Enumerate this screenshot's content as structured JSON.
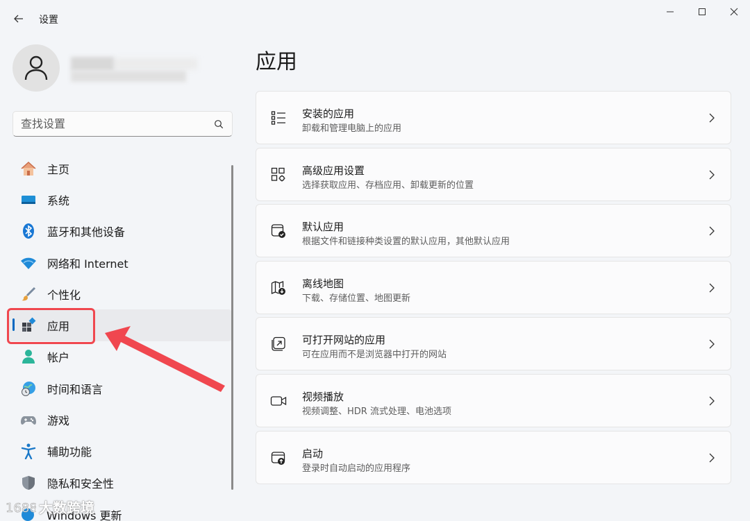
{
  "window": {
    "title": "设置"
  },
  "search": {
    "placeholder": "查找设置"
  },
  "nav": {
    "items": [
      {
        "label": "主页",
        "icon": "home-icon"
      },
      {
        "label": "系统",
        "icon": "system-icon"
      },
      {
        "label": "蓝牙和其他设备",
        "icon": "bluetooth-icon"
      },
      {
        "label": "网络和 Internet",
        "icon": "wifi-icon"
      },
      {
        "label": "个性化",
        "icon": "brush-icon"
      },
      {
        "label": "应用",
        "icon": "apps-icon",
        "active": true
      },
      {
        "label": "帐户",
        "icon": "account-icon"
      },
      {
        "label": "时间和语言",
        "icon": "globe-clock-icon"
      },
      {
        "label": "游戏",
        "icon": "gamepad-icon"
      },
      {
        "label": "辅助功能",
        "icon": "accessibility-icon"
      },
      {
        "label": "隐私和安全性",
        "icon": "shield-icon"
      }
    ],
    "partial_item": "Windows 更新"
  },
  "main": {
    "title": "应用",
    "cards": [
      {
        "title": "安装的应用",
        "subtitle": "卸载和管理电脑上的应用",
        "icon": "list-icon"
      },
      {
        "title": "高级应用设置",
        "subtitle": "选择获取应用、存档应用、卸载更新的位置",
        "icon": "app-settings-icon"
      },
      {
        "title": "默认应用",
        "subtitle": "根据文件和链接种类设置的默认应用，其他默认应用",
        "icon": "default-apps-icon"
      },
      {
        "title": "离线地图",
        "subtitle": "下载、存储位置、地图更新",
        "icon": "offline-map-icon"
      },
      {
        "title": "可打开网站的应用",
        "subtitle": "可在应用而不是浏览器中打开的网站",
        "icon": "open-link-icon"
      },
      {
        "title": "视频播放",
        "subtitle": "视频调整、HDR 流式处理、电池选项",
        "icon": "video-icon"
      },
      {
        "title": "启动",
        "subtitle": "登录时自动启动的应用程序",
        "icon": "startup-icon"
      }
    ]
  },
  "watermark": {
    "text": "大数跨境"
  },
  "colors": {
    "accent": "#0067c0",
    "annotation": "#f0474f"
  }
}
